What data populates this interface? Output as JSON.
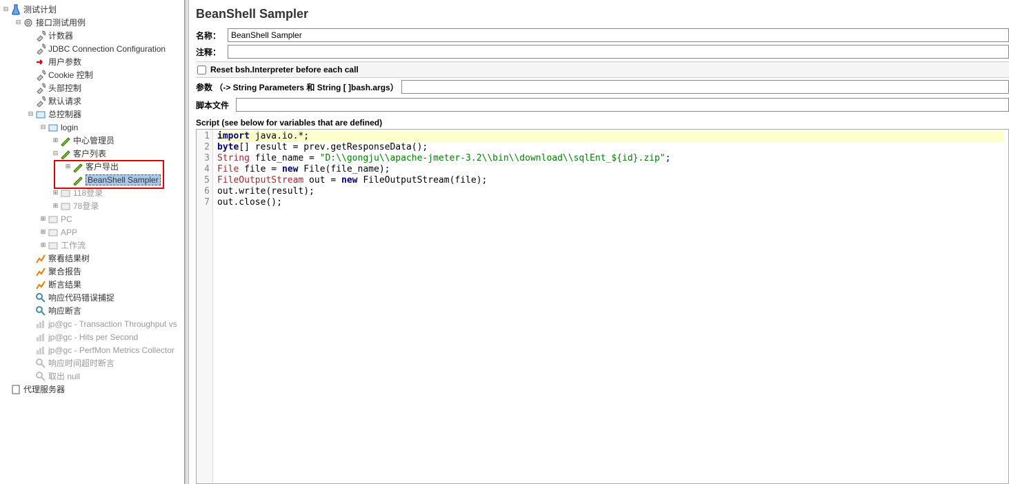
{
  "tree": {
    "root": "测试计划",
    "testcases": "接口测试用例",
    "counter": "计数器",
    "jdbc": "JDBC Connection Configuration",
    "userparams": "用户参数",
    "cookie": "Cookie 控制",
    "header": "头部控制",
    "default_req": "默认请求",
    "main_ctrl": "总控制器",
    "login": "login",
    "central_admin": "中心管理员",
    "customer_list": "客户列表",
    "customer_export": "客户导出",
    "beanshell": "BeanShell Sampler",
    "login118": "118登录",
    "login78": "78登录",
    "pc": "PC",
    "app": "APP",
    "workflow": "工作流",
    "view_results": "察看结果树",
    "aggregate": "聚合报告",
    "assertion_results": "断言结果",
    "response_code": "响应代码错误捕捉",
    "response_assert": "响应断言",
    "throughput": "jp@gc - Transaction Throughput vs",
    "hits": "jp@gc - Hits per Second",
    "perfmon": "jp@gc - PerfMon Metrics Collector",
    "response_timeout": "响应时间超时断言",
    "takeout": "取出 null",
    "proxy": "代理服务器"
  },
  "main": {
    "title": "BeanShell Sampler",
    "name_label": "名称：",
    "name_value": "BeanShell Sampler",
    "comment_label": "注释：",
    "comment_value": "",
    "reset_label": "Reset bsh.Interpreter before each call",
    "params_label": "参数 （-> String Parameters 和 String [ ]bash.args）",
    "params_value": "",
    "script_file_label": "脚本文件",
    "script_file_value": "",
    "script_label": "Script (see below for variables that are defined)"
  },
  "script": {
    "lines": [
      "1",
      "2",
      "3",
      "4",
      "5",
      "6",
      "7"
    ],
    "l1_a": "import",
    "l1_b": " java.io.*;",
    "l2_a": "byte",
    "l2_b": "[] result = prev.getResponseData();",
    "l3_a": "String",
    "l3_b": " file_name = ",
    "l3_c": "\"D:\\\\gongju\\\\apache-jmeter-3.2\\\\bin\\\\download\\\\sqlEnt_${id}.zip\"",
    "l3_d": ";",
    "l4_a": "File",
    "l4_b": " file = ",
    "l4_c": "new",
    "l4_d": " File(file_name);",
    "l5_a": "FileOutputStream",
    "l5_b": " out = ",
    "l5_c": "new",
    "l5_d": " FileOutputStream(file);",
    "l6": "out.write(result);",
    "l7": "out.close();"
  }
}
